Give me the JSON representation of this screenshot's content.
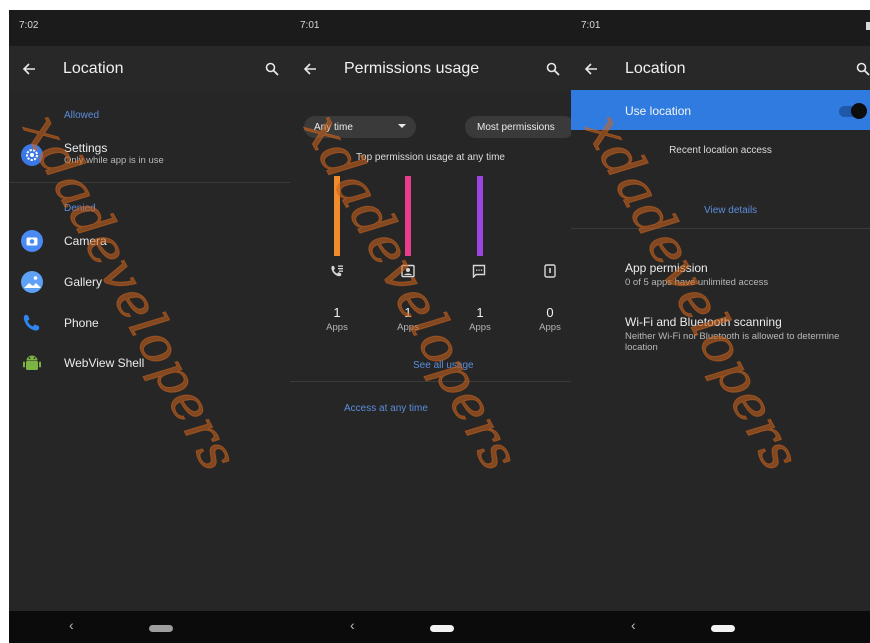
{
  "screen1": {
    "time": "7:02",
    "title": "Location",
    "section_allowed": "Allowed",
    "settings": {
      "title": "Settings",
      "subtitle": "Only while app is in use"
    },
    "section_denied": "Denied",
    "apps": [
      "Camera",
      "Gallery",
      "Phone",
      "WebView Shell"
    ]
  },
  "screen2": {
    "time": "7:01",
    "title": "Permissions usage",
    "filter_time": "Any time",
    "filter_sort": "Most permissions",
    "chart_title": "Top permission usage at any time",
    "stats": [
      {
        "count": "1",
        "label": "Apps"
      },
      {
        "count": "1",
        "label": "Apps"
      },
      {
        "count": "1",
        "label": "Apps"
      },
      {
        "count": "0",
        "label": "Apps"
      }
    ],
    "see_all": "See all usage",
    "access_any_time": "Access at any time"
  },
  "screen3": {
    "time": "7:01",
    "title": "Location",
    "use_location": "Use location",
    "toggle_on": true,
    "recent_access": "Recent location access",
    "view_details": "View details",
    "app_permission": {
      "title": "App permission",
      "subtitle": "0 of 5 apps have unlimited access"
    },
    "wifi_bt": {
      "title": "Wi-Fi and Bluetooth scanning",
      "subtitle": "Neither Wi-Fi nor Bluetooth is allowed to determine location"
    }
  },
  "colors": {
    "accent_blue": "#2f7be0",
    "bar_orange": "#f28b2c",
    "bar_pink": "#e83d8c",
    "bar_purple": "#9c45e0",
    "settings_icon": "#3b78e7",
    "camera_icon": "#4a8af4",
    "phone_icon": "#2f86f0",
    "android_icon": "#7cb342"
  },
  "watermark": "xdadevelopers"
}
